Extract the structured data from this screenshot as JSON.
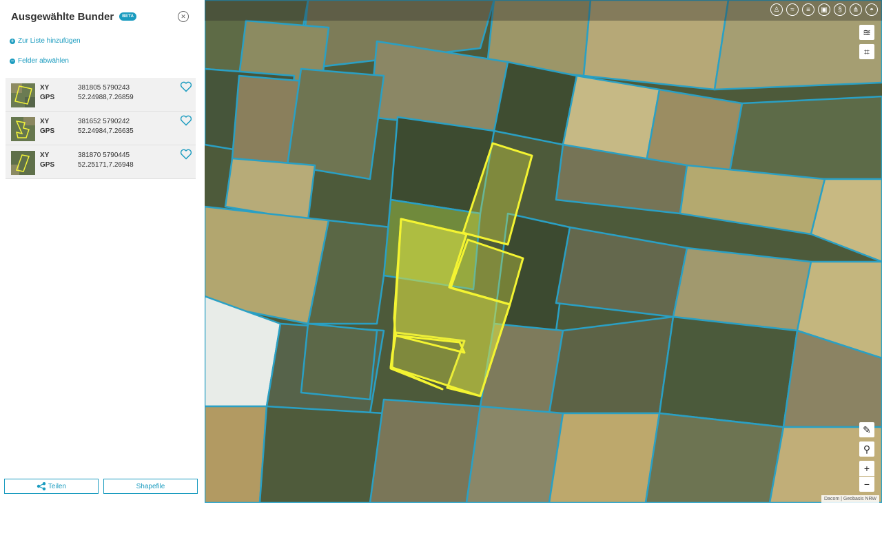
{
  "sidebar": {
    "title": "Ausgewählte Bunder",
    "beta_badge": "BETA",
    "actions": {
      "add_to_list": "Zur Liste hinzufügen",
      "deselect_fields": "Felder abwählen"
    },
    "fields": [
      {
        "xy_label": "XY",
        "xy": "381805 5790243",
        "gps_label": "GPS",
        "gps": "52.24988,7.26859",
        "favorite": false
      },
      {
        "xy_label": "XY",
        "xy": "381652 5790242",
        "gps_label": "GPS",
        "gps": "52.24984,7.26635",
        "favorite": false
      },
      {
        "xy_label": "XY",
        "xy": "381870 5790445",
        "gps_label": "GPS",
        "gps": "52.25171,7.26948",
        "favorite": false
      }
    ],
    "buttons": {
      "share": "Teilen",
      "shapefile": "Shapefile"
    }
  },
  "map": {
    "toolbar_icons": [
      "owner-icon",
      "measure-icon",
      "list-icon",
      "print-icon",
      "paragraph-icon",
      "network-icon",
      "weather-icon"
    ],
    "zoom_in": "+",
    "zoom_out": "−",
    "attribution": "Dacom | Geobasis NRW"
  },
  "colors": {
    "accent": "#1a9bbf",
    "selection": "#f2f23a",
    "parcel_border": "#2aa0c4"
  }
}
